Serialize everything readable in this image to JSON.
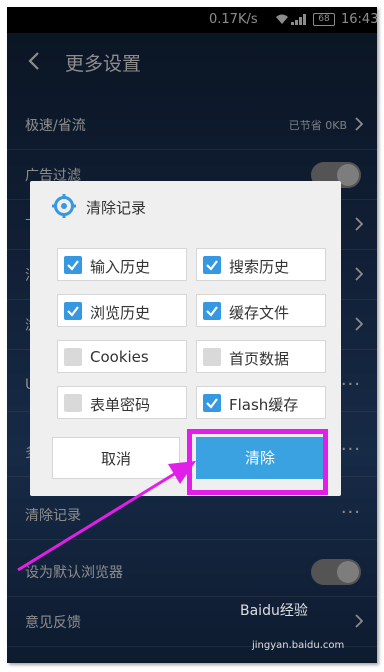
{
  "status_bar": {
    "network_speed": "0.17K/s",
    "battery": "68",
    "time": "16:43",
    "icons": [
      "wifi-icon",
      "signal-icon",
      "battery-icon"
    ]
  },
  "header": {
    "title": "更多设置",
    "back_icon": "chevron-left-icon"
  },
  "settings": {
    "turbo": {
      "label": "极速/省流",
      "value": "已节省 0KB"
    },
    "ad_filter": {
      "label": "广告过滤",
      "toggle": "off"
    },
    "partial_rows": [
      "下",
      "消",
      "浏",
      "U",
      "多"
    ],
    "clear_history": {
      "label": "清除记录"
    },
    "default_browser": {
      "label": "设为默认浏览器",
      "toggle": "off"
    },
    "feedback": {
      "label": "意见反馈"
    }
  },
  "dialog": {
    "title": "清除记录",
    "options": [
      {
        "label": "输入历史",
        "checked": true
      },
      {
        "label": "搜索历史",
        "checked": true
      },
      {
        "label": "浏览历史",
        "checked": true
      },
      {
        "label": "缓存文件",
        "checked": true
      },
      {
        "label": "Cookies",
        "checked": false
      },
      {
        "label": "首页数据",
        "checked": false
      },
      {
        "label": "表单密码",
        "checked": false
      },
      {
        "label": "Flash缓存",
        "checked": true
      }
    ],
    "cancel_label": "取消",
    "confirm_label": "清除"
  },
  "watermark": {
    "brand": "Baidu经验",
    "url": "jingyan.baidu.com"
  },
  "colors": {
    "accent": "#3aa2e0",
    "checkbox_on": "#3598e1",
    "highlight": "#e21ee9"
  }
}
